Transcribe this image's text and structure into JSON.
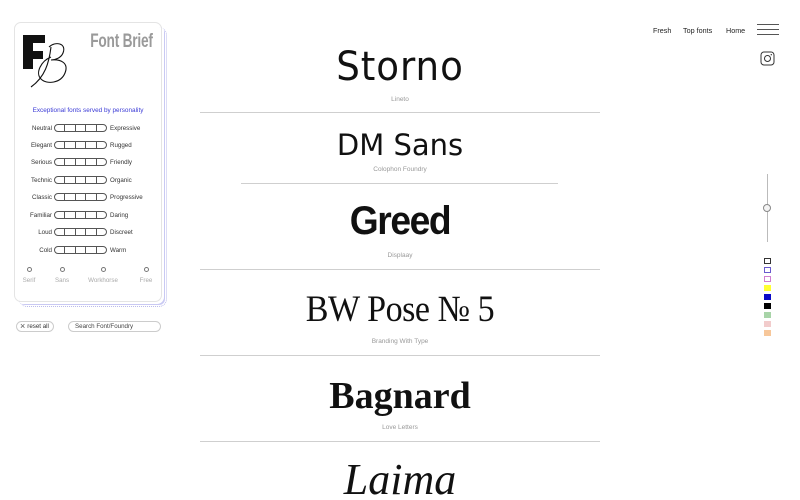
{
  "brand": {
    "logo_letters": "FB",
    "name": "Font Brief"
  },
  "sidebar": {
    "tagline": "Exceptional fonts served by personality",
    "sliders": [
      {
        "left": "Neutral",
        "right": "Expressive"
      },
      {
        "left": "Elegant",
        "right": "Rugged"
      },
      {
        "left": "Serious",
        "right": "Friendly"
      },
      {
        "left": "Technic",
        "right": "Organic"
      },
      {
        "left": "Classic",
        "right": "Progressive"
      },
      {
        "left": "Familiar",
        "right": "Daring"
      },
      {
        "left": "Loud",
        "right": "Discreet"
      },
      {
        "left": "Cold",
        "right": "Warm"
      }
    ],
    "categories": [
      "Serif",
      "Sans",
      "Workhorse",
      "Free"
    ],
    "reset_label": "reset all",
    "search_placeholder": "Search Font/Foundry"
  },
  "nav": {
    "fresh": "Fresh",
    "top_fonts": "Top fonts",
    "home": "Home"
  },
  "fonts": [
    {
      "name": "Storno",
      "foundry": "Lineto"
    },
    {
      "name": "DM Sans",
      "foundry": "Colophon Foundry"
    },
    {
      "name": "Greed",
      "foundry": "Displaay"
    },
    {
      "name": "BW Pose № 5",
      "foundry": "Branding With Type"
    },
    {
      "name": "Bagnard",
      "foundry": "Love Letters"
    },
    {
      "name": "Laima",
      "foundry": ""
    }
  ],
  "color_swatches": [
    "#ffffff",
    "#ffffff",
    "#ffffff",
    "#ffff33",
    "#0a0ac8",
    "#000000",
    "#a8d4a8",
    "#f2cccc",
    "#f7c79a"
  ],
  "swatch_borders": [
    "#333333",
    "#6a5acd",
    "#d07fd0",
    null,
    null,
    null,
    null,
    null,
    null
  ]
}
